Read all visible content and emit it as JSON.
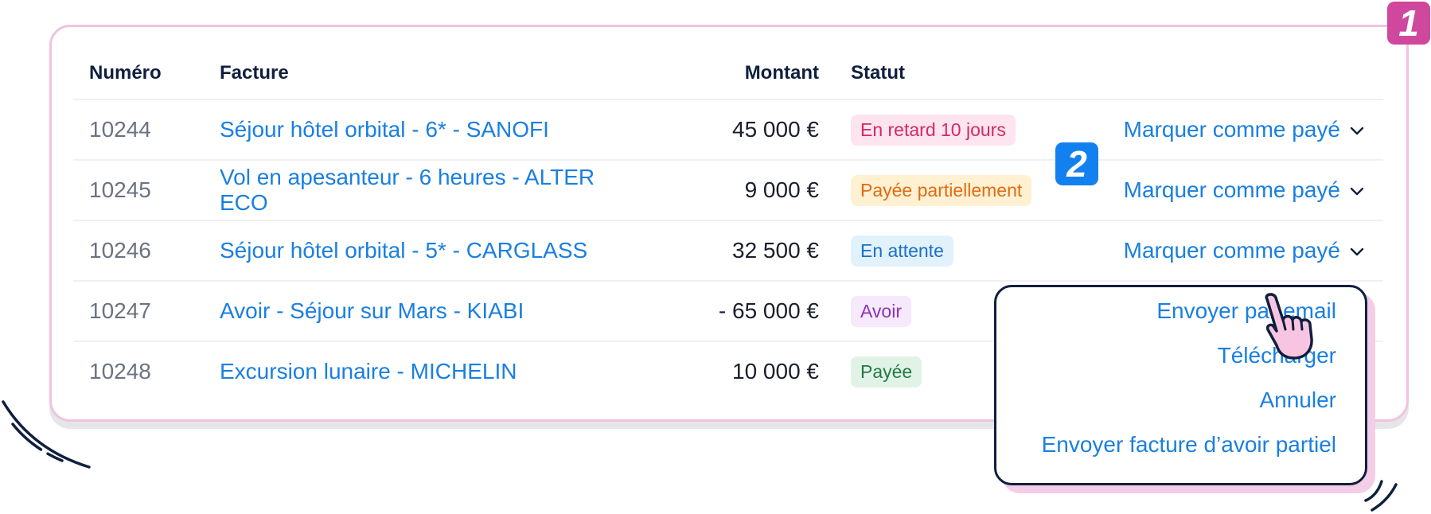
{
  "badges": {
    "first": "1",
    "second": "2"
  },
  "table": {
    "headers": {
      "numero": "Numéro",
      "facture": "Facture",
      "montant": "Montant",
      "statut": "Statut"
    },
    "rows": [
      {
        "numero": "10244",
        "facture": "Séjour hôtel orbital - 6* - SANOFI",
        "montant": "45 000 €",
        "statut": "En retard 10 jours",
        "action": "Marquer comme payé"
      },
      {
        "numero": "10245",
        "facture": "Vol en apesanteur - 6 heures - ALTER ECO",
        "montant": "9 000 €",
        "statut": "Payée partiellement",
        "action": "Marquer comme payé"
      },
      {
        "numero": "10246",
        "facture": "Séjour hôtel orbital - 5* - CARGLASS",
        "montant": "32 500 €",
        "statut": "En attente",
        "action": "Marquer comme payé"
      },
      {
        "numero": "10247",
        "facture": "Avoir - Séjour sur Mars - KIABI",
        "montant": "- 65 000 €",
        "statut": "Avoir",
        "action": ""
      },
      {
        "numero": "10248",
        "facture": "Excursion lunaire - MICHELIN",
        "montant": "10 000 €",
        "statut": "Payée",
        "action": ""
      }
    ]
  },
  "status_colors": {
    "late": {
      "bg": "#fde4ee",
      "fg": "#d02a67"
    },
    "partial": {
      "bg": "#fff1d1",
      "fg": "#e26a14"
    },
    "pending": {
      "bg": "#e2f2fd",
      "fg": "#1b6fc7"
    },
    "credit": {
      "bg": "#f5e9fb",
      "fg": "#8a35b5"
    },
    "paid": {
      "bg": "#e1f3e6",
      "fg": "#237a45"
    }
  },
  "dropdown": {
    "items": [
      "Envoyer par email",
      "Télécharger",
      "Annuler",
      "Envoyer facture d’avoir partiel"
    ]
  },
  "icons": {
    "chevron": "chevron-down-icon",
    "pointer": "pointing-hand-cursor-icon"
  },
  "colors": {
    "accent_blue": "#1a7fe0",
    "accent_pink": "#d0479e",
    "navy": "#0f1f3d"
  }
}
